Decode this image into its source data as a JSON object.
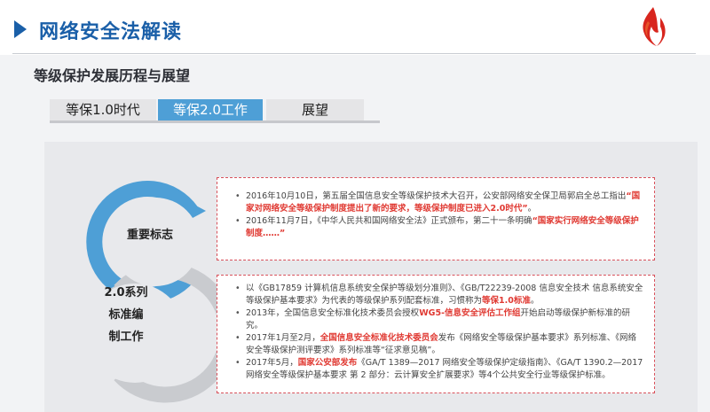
{
  "header": {
    "title": "网络安全法解读",
    "logo_icon": "flame-logo-icon",
    "accent_color": "#1a5fa8"
  },
  "section": {
    "title": "等级保护发展历程与展望"
  },
  "tabs": [
    {
      "label": "等保1.0时代",
      "active": false
    },
    {
      "label": "等保2.0工作",
      "active": true
    },
    {
      "label": "展望",
      "active": false
    }
  ],
  "cycle": {
    "milestone_label": "重要标志",
    "series_line1": "2.0系列",
    "series_line2": "标准编",
    "series_line3": "制工作"
  },
  "box1": {
    "item1": {
      "text_a": "2016年10月10日，第五届全国信息安全等级保护技术大召开，公安部网络安全保卫局郭启全总工指出",
      "text_b_red": "“国家对网络安全等级保护制度提出了新的要求，等级保护制度已进入2.0时代”",
      "text_c": "。"
    },
    "item2": {
      "text_a": "2016年11月7日，《中华人民共和国网络安全法》正式颁布，第二十一条明确",
      "text_b_red": "“国家实行网络安全等级保护制度……”"
    }
  },
  "box2": {
    "item1": {
      "text_a": "以《GB17859 计算机信息系统安全保护等级划分准则》、《GB/T22239-2008 信息安全技术 信息系统安全等级保护基本要求》为代表的等级保护系列配套标准，习惯称为",
      "text_b_red": "等保1.0标准",
      "text_c": "。"
    },
    "item2": {
      "text_a": "2013年，全国信息安全标准化技术委员会授权",
      "text_b_red": "WG5-信息安全评估工作组",
      "text_c": "开始启动等级保护新标准的研究。"
    },
    "item3": {
      "text_a": "2017年1月至2月，",
      "text_b_red": "全国信息安全标准化技术委员会",
      "text_c": "发布《网络安全等级保护基本要求》系列标准、《网络安全等级保护测评要求》系列标准等“征求意见稿”。"
    },
    "item4": {
      "text_a": "2017年5月，",
      "text_b_red": "国家公安部发布",
      "text_c": "《GA/T 1389—2017 网络安全等级保护定级指南》、《GA/T 1390.2—2017 网络安全等级保护基本要求 第 2 部分：云计算安全扩展要求》等4个公共安全行业等级保护标准。"
    }
  }
}
